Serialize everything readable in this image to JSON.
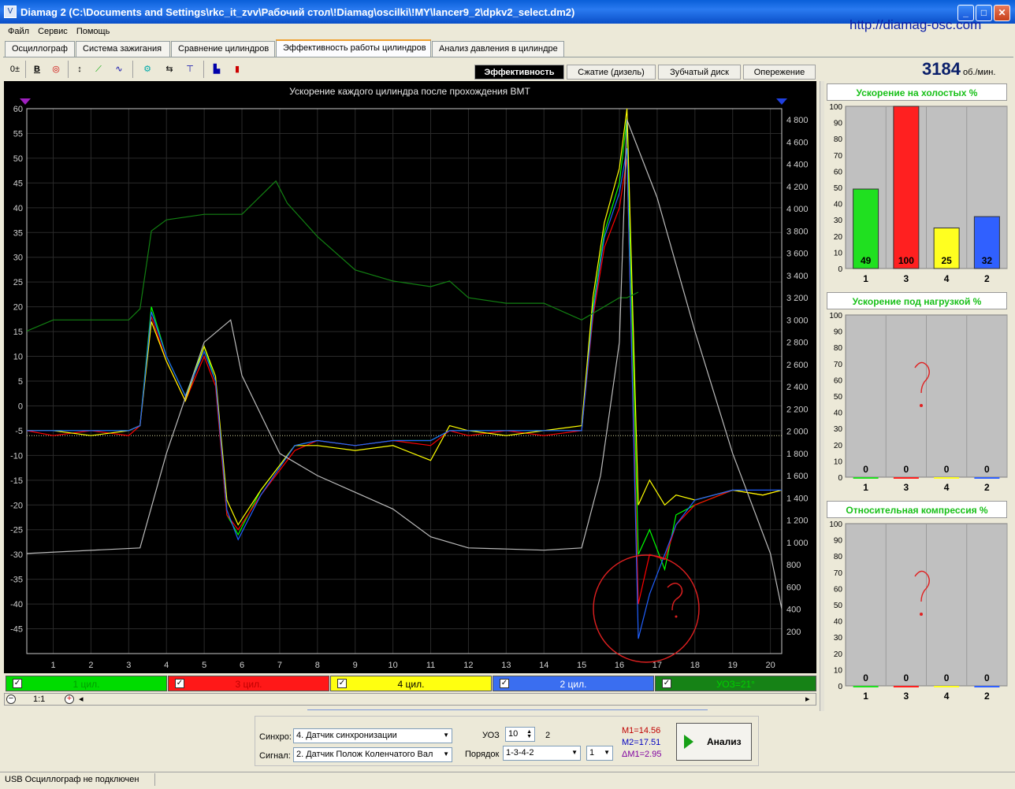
{
  "window": {
    "title": "Diamag 2 (C:\\Documents and Settings\\rkc_it_zvv\\Рабочий стол\\!Diamag\\oscilki\\!MY\\lancer9_2\\dpkv2_select.dm2)",
    "url": "http://diamag-osc.com"
  },
  "menu": [
    "Файл",
    "Сервис",
    "Помощь"
  ],
  "tabs": [
    "Осциллограф",
    "Система зажигания",
    "Сравнение цилиндров",
    "Эффективность работы цилиндров",
    "Анализ давления в цилиндре"
  ],
  "active_tab": "Эффективность работы цилиндров",
  "subtabs": [
    "Эффективность",
    "Сжатие (дизель)",
    "Зубчатый диск",
    "Опережение"
  ],
  "rpm": {
    "value": "3184",
    "unit": "об./мин."
  },
  "chart_data": {
    "type": "line",
    "title": "Ускорение каждого цилиндра после прохождения ВМТ",
    "x_ticks": [
      "1",
      "2",
      "3",
      "4",
      "5",
      "6",
      "7",
      "8",
      "9",
      "10",
      "11",
      "12",
      "13",
      "14",
      "15",
      "16",
      "17",
      "18",
      "19",
      "20"
    ],
    "y_left_ticks": [
      "60",
      "55",
      "50",
      "45",
      "40",
      "35",
      "30",
      "25",
      "20",
      "15",
      "10",
      "5",
      "0",
      "-5",
      "-10",
      "-15",
      "-20",
      "-25",
      "-30",
      "-35",
      "-40",
      "-45"
    ],
    "y_right_ticks": [
      "4 800",
      "4 600",
      "4 400",
      "4 200",
      "4 000",
      "3 800",
      "3 600",
      "3 400",
      "3 200",
      "3 000",
      "2 800",
      "2 600",
      "2 400",
      "2 200",
      "2 000",
      "1 800",
      "1 600",
      "1 400",
      "1 200",
      "1 000",
      "800",
      "600",
      "400",
      "200"
    ],
    "xlim": [
      0.3,
      20.3
    ],
    "ylim": [
      -50,
      60
    ],
    "y2lim": [
      0,
      4900
    ],
    "legend_placement": "bottom",
    "series": [
      {
        "name": "1 цил.",
        "color": "#00ff00",
        "x": [
          0.3,
          1,
          2,
          3,
          3.3,
          3.6,
          4,
          4.5,
          5,
          5.3,
          5.6,
          5.9,
          6.5,
          7.4,
          8,
          9,
          10,
          11,
          11.5,
          12,
          13,
          14,
          15,
          15.3,
          15.6,
          16,
          16.2,
          16.5,
          16.8,
          17.2,
          17.5,
          18,
          19,
          19.8,
          20.3
        ],
        "y": [
          -5,
          -5,
          -5,
          -5,
          -4,
          20,
          10,
          2,
          12,
          5,
          -22,
          -26,
          -17,
          -8,
          -7,
          -8,
          -7,
          -7,
          -5,
          -5,
          -5,
          -5,
          -5,
          20,
          35,
          45,
          58,
          -30,
          -25,
          -33,
          -22,
          -20,
          -17,
          -18,
          -17
        ]
      },
      {
        "name": "3 цил.",
        "color": "#ff0000",
        "x": [
          0.3,
          1,
          2,
          3,
          3.3,
          3.6,
          4,
          4.5,
          5,
          5.3,
          5.6,
          5.9,
          6.5,
          7.4,
          8,
          9,
          10,
          11,
          11.5,
          12,
          13,
          14,
          15,
          15.3,
          15.6,
          16,
          16.2,
          16.5,
          16.8,
          17.2,
          17.5,
          18,
          19,
          19.8,
          20.3
        ],
        "y": [
          -5,
          -6,
          -5,
          -6,
          -4,
          18,
          9,
          1,
          10,
          4,
          -22,
          -25,
          -18,
          -9,
          -7,
          -8,
          -7,
          -8,
          -5,
          -6,
          -5,
          -6,
          -5,
          18,
          32,
          40,
          50,
          -40,
          -30,
          -31,
          -24,
          -20,
          -17,
          -18,
          -17
        ]
      },
      {
        "name": "4 цил.",
        "color": "#ffff00",
        "x": [
          0.3,
          1,
          2,
          3,
          3.3,
          3.6,
          4,
          4.5,
          5,
          5.3,
          5.6,
          5.9,
          6.5,
          7.4,
          8,
          9,
          10,
          11,
          11.5,
          12,
          13,
          14,
          15,
          15.3,
          15.6,
          16,
          16.2,
          16.5,
          16.8,
          17.2,
          17.5,
          18,
          19,
          19.8,
          20.3
        ],
        "y": [
          -5,
          -5,
          -6,
          -5,
          -4,
          17,
          9,
          1,
          12,
          6,
          -19,
          -24,
          -17,
          -8,
          -8,
          -9,
          -8,
          -11,
          -4,
          -5,
          -6,
          -5,
          -4,
          22,
          37,
          48,
          60,
          -20,
          -15,
          -20,
          -18,
          -19,
          -17,
          -18,
          -17
        ]
      },
      {
        "name": "2 цил.",
        "color": "#2060ff",
        "x": [
          0.3,
          1,
          2,
          3,
          3.3,
          3.6,
          4,
          4.5,
          5,
          5.3,
          5.6,
          5.9,
          6.5,
          7.4,
          8,
          9,
          10,
          11,
          11.5,
          12,
          13,
          14,
          15,
          15.3,
          15.6,
          16,
          16.2,
          16.5,
          16.8,
          17.2,
          17.5,
          18,
          19,
          19.8,
          20.3
        ],
        "y": [
          -5,
          -5,
          -5,
          -5,
          -4,
          19,
          10,
          2,
          11,
          5,
          -21,
          -27,
          -18,
          -8,
          -7,
          -8,
          -7,
          -7,
          -5,
          -5,
          -5,
          -5,
          -5,
          19,
          34,
          43,
          52,
          -47,
          -38,
          -30,
          -24,
          -19,
          -17,
          -17,
          -17
        ]
      },
      {
        "name": "УОЗ=21°",
        "color": "#128012",
        "axis": "right",
        "x": [
          0.3,
          1,
          2,
          3,
          3.3,
          3.6,
          4,
          5,
          6,
          6.9,
          7.2,
          8,
          9,
          10,
          11,
          11.5,
          12,
          13,
          14,
          15,
          15.5,
          16,
          16.2,
          16.5
        ],
        "y2": [
          2900,
          3000,
          3000,
          3000,
          3100,
          3800,
          3900,
          3950,
          3950,
          4250,
          4050,
          3750,
          3450,
          3350,
          3300,
          3350,
          3200,
          3150,
          3150,
          3000,
          3100,
          3200,
          3200,
          3250
        ]
      },
      {
        "name": "",
        "color": "#bbbbbb",
        "axis": "right",
        "x": [
          0.3,
          3.3,
          4,
          5,
          5.7,
          6,
          7,
          8,
          9,
          10,
          11,
          12,
          13,
          14,
          15,
          15.5,
          16,
          16.2,
          17,
          18,
          19,
          20,
          20.3
        ],
        "y2": [
          900,
          950,
          1800,
          2800,
          3000,
          2500,
          1800,
          1600,
          1450,
          1300,
          1050,
          950,
          940,
          930,
          950,
          1600,
          2800,
          4800,
          4100,
          2900,
          1800,
          900,
          400
        ]
      }
    ],
    "reference_line_y": -6
  },
  "legend_chips": [
    {
      "label": "1 цил.",
      "color": "#00dc00",
      "text_color": "#00a000"
    },
    {
      "label": "3 цил.",
      "color": "#ff1818",
      "text_color": "#c00000"
    },
    {
      "label": "4 цил.",
      "color": "#ffff10",
      "text_color": "#000000"
    },
    {
      "label": "2 цил.",
      "color": "#3a6ef0",
      "text_color": "#ffffff"
    },
    {
      "label": "УОЗ=21°",
      "color": "#168216",
      "text_color": "#00d000"
    }
  ],
  "zoom": "1:1",
  "controls": {
    "sync_label": "Синхро:",
    "sync_value": "4. Датчик синхронизации",
    "signal_label": "Сигнал:",
    "signal_value": "2. Датчик Полож Коленчатого Вал",
    "uoz_label": "УОЗ",
    "uoz_value": "10",
    "uoz_extra": "2",
    "order_label": "Порядок",
    "order_value": "1-3-4-2",
    "order_num": "1",
    "m1": "M1=14.56",
    "m2": "M2=17.51",
    "dm1": "ΔM1=2.95",
    "analyze": "Анализ"
  },
  "status": "USB Осциллограф не подключен",
  "panels": [
    {
      "title": "Ускорение на холостых %",
      "categories": [
        "1",
        "3",
        "4",
        "2"
      ],
      "values": [
        49,
        100,
        25,
        32
      ],
      "colors": [
        "#20e020",
        "#ff2020",
        "#ffff20",
        "#3060ff"
      ],
      "y_ticks": [
        "100",
        "90",
        "80",
        "70",
        "60",
        "50",
        "40",
        "30",
        "20",
        "10",
        "0"
      ]
    },
    {
      "title": "Ускорение под нагрузкой %",
      "categories": [
        "1",
        "3",
        "4",
        "2"
      ],
      "values": [
        0,
        0,
        0,
        0
      ],
      "colors": [
        "#20e020",
        "#ff2020",
        "#ffff20",
        "#3060ff"
      ],
      "y_ticks": [
        "100",
        "90",
        "80",
        "70",
        "60",
        "50",
        "40",
        "30",
        "20",
        "10",
        "0"
      ]
    },
    {
      "title": "Относительная компрессия %",
      "categories": [
        "1",
        "3",
        "4",
        "2"
      ],
      "values": [
        0,
        0,
        0,
        0
      ],
      "colors": [
        "#20e020",
        "#ff2020",
        "#ffff20",
        "#3060ff"
      ],
      "y_ticks": [
        "100",
        "90",
        "80",
        "70",
        "60",
        "50",
        "40",
        "30",
        "20",
        "10",
        "0"
      ]
    }
  ]
}
